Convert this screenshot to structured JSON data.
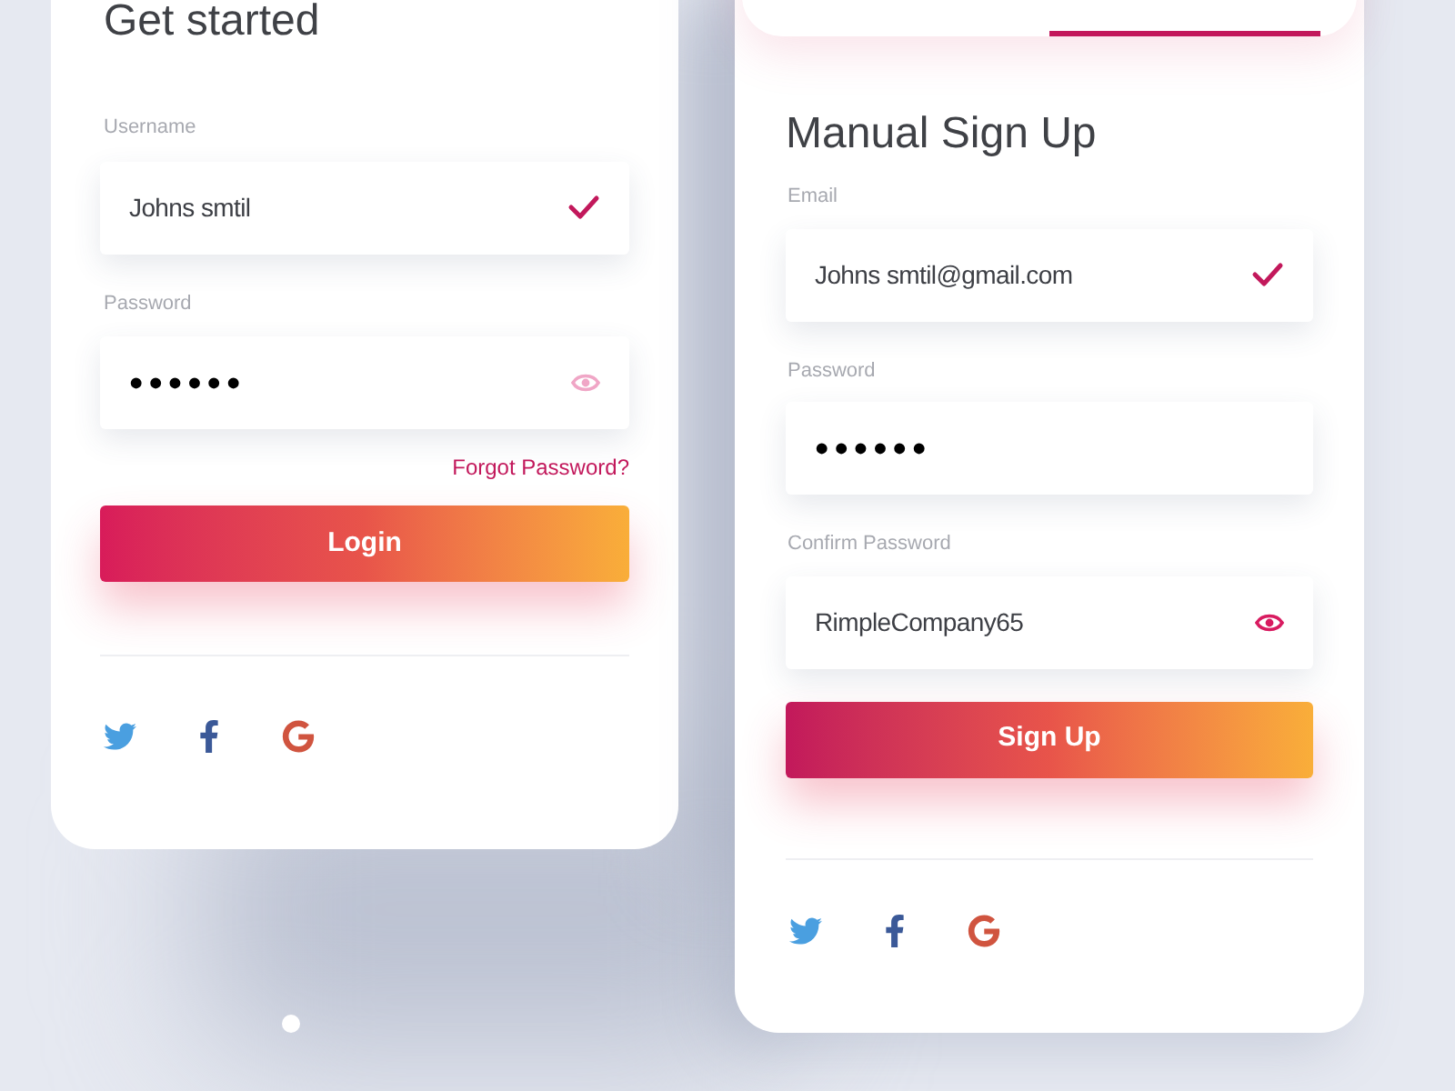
{
  "login_card": {
    "title": "Get started",
    "fields": [
      {
        "label": "Username",
        "value": "Johns smtil",
        "kind": "validated"
      },
      {
        "label": "Password",
        "value": "••••••",
        "kind": "secret",
        "revealed": false
      }
    ],
    "forgot_link": "Forgot Password?",
    "button": "Login"
  },
  "signup_card": {
    "title": "Manual Sign Up",
    "fields": [
      {
        "label": "Email",
        "value": "Johns smtil@gmail.com",
        "kind": "validated"
      },
      {
        "label": "Password",
        "value": "••••••",
        "kind": "plain"
      },
      {
        "label": "Confirm Password",
        "value": "RimpleCompany65",
        "kind": "secret",
        "revealed": true
      }
    ],
    "button": "Sign Up"
  }
}
